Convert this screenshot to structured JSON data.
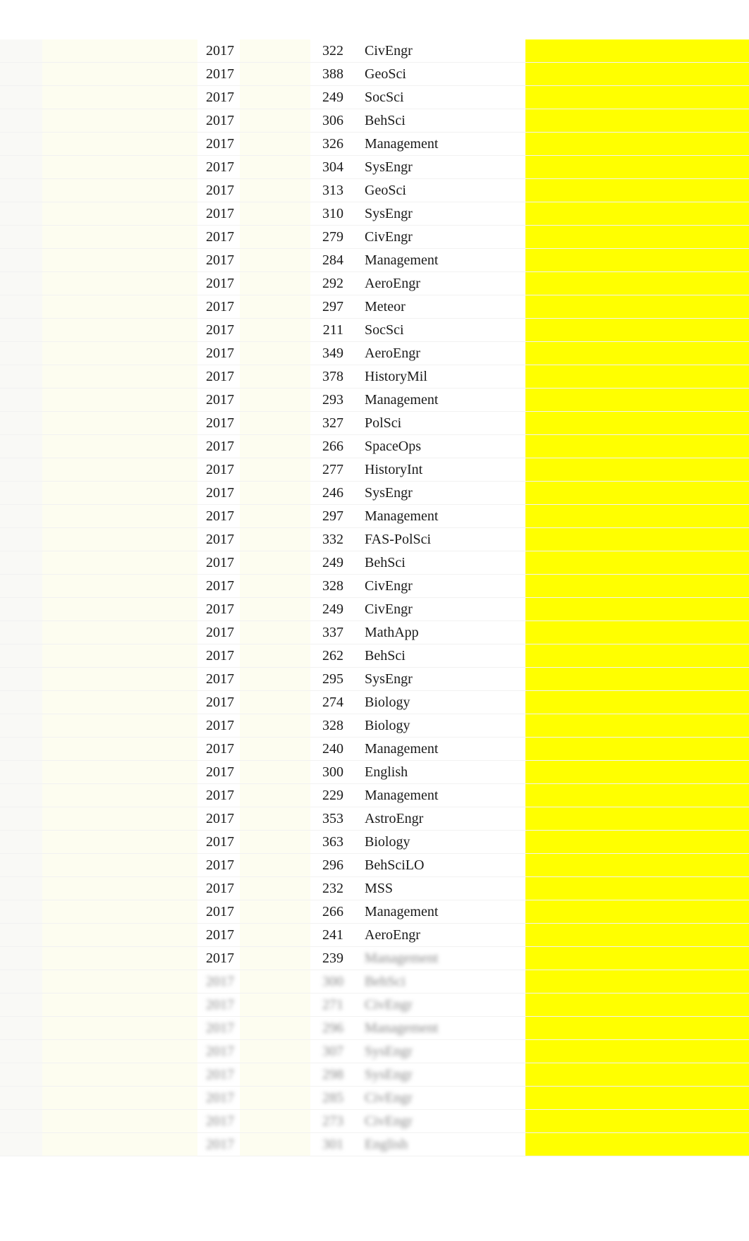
{
  "rows": [
    {
      "year": "2017",
      "value": "322",
      "disc": "CivEngr",
      "state": "clear"
    },
    {
      "year": "2017",
      "value": "388",
      "disc": "GeoSci",
      "state": "clear"
    },
    {
      "year": "2017",
      "value": "249",
      "disc": "SocSci",
      "state": "clear"
    },
    {
      "year": "2017",
      "value": "306",
      "disc": "BehSci",
      "state": "clear"
    },
    {
      "year": "2017",
      "value": "326",
      "disc": "Management",
      "state": "clear"
    },
    {
      "year": "2017",
      "value": "304",
      "disc": "SysEngr",
      "state": "clear"
    },
    {
      "year": "2017",
      "value": "313",
      "disc": "GeoSci",
      "state": "clear"
    },
    {
      "year": "2017",
      "value": "310",
      "disc": "SysEngr",
      "state": "clear"
    },
    {
      "year": "2017",
      "value": "279",
      "disc": "CivEngr",
      "state": "clear"
    },
    {
      "year": "2017",
      "value": "284",
      "disc": "Management",
      "state": "clear"
    },
    {
      "year": "2017",
      "value": "292",
      "disc": "AeroEngr",
      "state": "clear"
    },
    {
      "year": "2017",
      "value": "297",
      "disc": "Meteor",
      "state": "clear"
    },
    {
      "year": "2017",
      "value": "211",
      "disc": "SocSci",
      "state": "clear"
    },
    {
      "year": "2017",
      "value": "349",
      "disc": "AeroEngr",
      "state": "clear"
    },
    {
      "year": "2017",
      "value": "378",
      "disc": "HistoryMil",
      "state": "clear"
    },
    {
      "year": "2017",
      "value": "293",
      "disc": "Management",
      "state": "clear"
    },
    {
      "year": "2017",
      "value": "327",
      "disc": "PolSci",
      "state": "clear"
    },
    {
      "year": "2017",
      "value": "266",
      "disc": "SpaceOps",
      "state": "clear"
    },
    {
      "year": "2017",
      "value": "277",
      "disc": "HistoryInt",
      "state": "clear"
    },
    {
      "year": "2017",
      "value": "246",
      "disc": "SysEngr",
      "state": "clear"
    },
    {
      "year": "2017",
      "value": "297",
      "disc": "Management",
      "state": "clear"
    },
    {
      "year": "2017",
      "value": "332",
      "disc": "FAS-PolSci",
      "state": "clear"
    },
    {
      "year": "2017",
      "value": "249",
      "disc": "BehSci",
      "state": "clear"
    },
    {
      "year": "2017",
      "value": "328",
      "disc": "CivEngr",
      "state": "clear"
    },
    {
      "year": "2017",
      "value": "249",
      "disc": "CivEngr",
      "state": "clear"
    },
    {
      "year": "2017",
      "value": "337",
      "disc": "MathApp",
      "state": "clear"
    },
    {
      "year": "2017",
      "value": "262",
      "disc": "BehSci",
      "state": "clear"
    },
    {
      "year": "2017",
      "value": "295",
      "disc": "SysEngr",
      "state": "clear"
    },
    {
      "year": "2017",
      "value": "274",
      "disc": "Biology",
      "state": "clear"
    },
    {
      "year": "2017",
      "value": "328",
      "disc": "Biology",
      "state": "clear"
    },
    {
      "year": "2017",
      "value": "240",
      "disc": "Management",
      "state": "clear"
    },
    {
      "year": "2017",
      "value": "300",
      "disc": "English",
      "state": "clear"
    },
    {
      "year": "2017",
      "value": "229",
      "disc": "Management",
      "state": "clear"
    },
    {
      "year": "2017",
      "value": "353",
      "disc": "AstroEngr",
      "state": "clear"
    },
    {
      "year": "2017",
      "value": "363",
      "disc": "Biology",
      "state": "clear"
    },
    {
      "year": "2017",
      "value": "296",
      "disc": "BehSciLO",
      "state": "clear"
    },
    {
      "year": "2017",
      "value": "232",
      "disc": "MSS",
      "state": "clear"
    },
    {
      "year": "2017",
      "value": "266",
      "disc": "Management",
      "state": "clear"
    },
    {
      "year": "2017",
      "value": "241",
      "disc": "AeroEngr",
      "state": "clear"
    },
    {
      "year": "2017",
      "value": "239",
      "disc": "Management",
      "state": "partial"
    },
    {
      "year": "2017",
      "value": "300",
      "disc": "BehSci",
      "state": "blurred"
    },
    {
      "year": "2017",
      "value": "271",
      "disc": "CivEngr",
      "state": "blurred"
    },
    {
      "year": "2017",
      "value": "296",
      "disc": "Management",
      "state": "blurred"
    },
    {
      "year": "2017",
      "value": "307",
      "disc": "SysEngr",
      "state": "blurred"
    },
    {
      "year": "2017",
      "value": "298",
      "disc": "SysEngr",
      "state": "blurred"
    },
    {
      "year": "2017",
      "value": "285",
      "disc": "CivEngr",
      "state": "blurred"
    },
    {
      "year": "2017",
      "value": "273",
      "disc": "CivEngr",
      "state": "blurred"
    },
    {
      "year": "2017",
      "value": "301",
      "disc": "English",
      "state": "blurred"
    }
  ]
}
